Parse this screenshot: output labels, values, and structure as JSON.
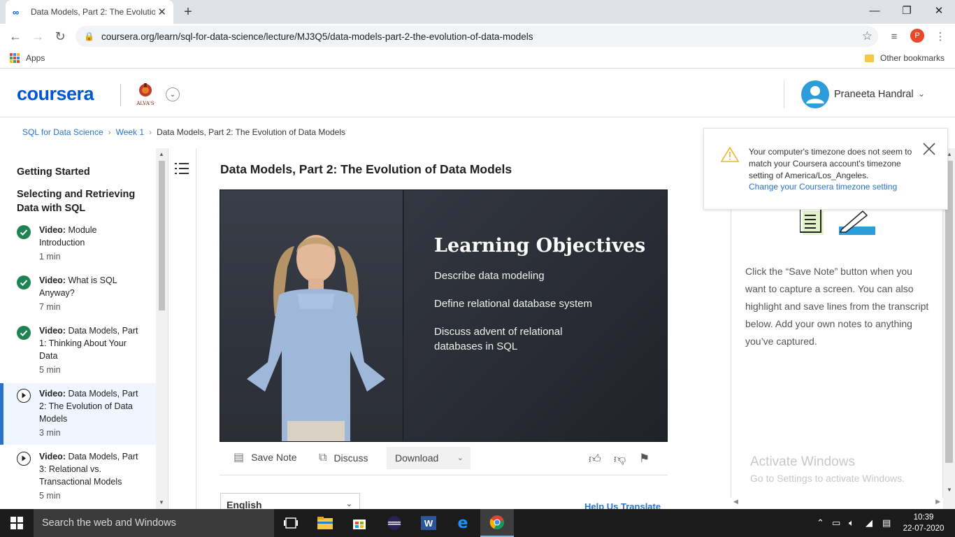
{
  "browser": {
    "tab_title": "Data Models, Part 2: The Evolutio",
    "url": "coursera.org/learn/sql-for-data-science/lecture/MJ3Q5/data-models-part-2-the-evolution-of-data-models",
    "bookmarks": {
      "apps_label": "Apps",
      "other_label": "Other bookmarks"
    },
    "profile_initial": "P"
  },
  "header": {
    "logo": "coursera",
    "partner_logo_text": "ALVA'S",
    "user_name": "Praneeta Handral"
  },
  "breadcrumb": {
    "course": "SQL for Data Science",
    "week": "Week 1",
    "current": "Data Models, Part 2: The Evolution of Data Models",
    "separator": "›"
  },
  "sidebar": {
    "section_1": "Getting Started",
    "section_2": "Selecting and Retrieving Data with SQL",
    "items": [
      {
        "type": "Video:",
        "title": "Module Introduction",
        "duration": "1 min",
        "status": "done"
      },
      {
        "type": "Video:",
        "title": "What is SQL Anyway?",
        "duration": "7 min",
        "status": "done"
      },
      {
        "type": "Video:",
        "title": "Data Models, Part 1: Thinking About Your Data",
        "duration": "5 min",
        "status": "done"
      },
      {
        "type": "Video:",
        "title": "Data Models, Part 2: The Evolution of Data Models",
        "duration": "3 min",
        "status": "current"
      },
      {
        "type": "Video:",
        "title": "Data Models, Part 3: Relational vs. Transactional Models",
        "duration": "5 min",
        "status": "todo"
      }
    ]
  },
  "lecture": {
    "title": "Data Models, Part 2: The Evolution of Data Models",
    "slide": {
      "heading": "Learning Objectives",
      "points": [
        "Describe data modeling",
        "Define relational database system",
        "Discuss advent of relational databases in SQL"
      ]
    },
    "actions": {
      "save_note": "Save Note",
      "discuss": "Discuss",
      "download": "Download"
    },
    "language": "English",
    "help_translate": "Help Us Translate"
  },
  "notes": {
    "instructions": "Click the “Save Note” button when you want to capture a screen. You can also highlight and save lines from the transcript below. Add your own notes to anything you’ve captured.",
    "watermark_title": "Activate Windows",
    "watermark_sub": "Go to Settings to activate Windows."
  },
  "timezone_alert": {
    "message": "Your computer's timezone does not seem to match your Coursera account's timezone setting of America/Los_Angeles.",
    "link": "Change your Coursera timezone setting"
  },
  "taskbar": {
    "search_placeholder": "Search the web and Windows",
    "time": "10:39",
    "date": "22-07-2020"
  },
  "colors": {
    "accent": "#0056d2",
    "link": "#2a73cc",
    "complete": "#1f8354",
    "warning": "#f0b429"
  }
}
